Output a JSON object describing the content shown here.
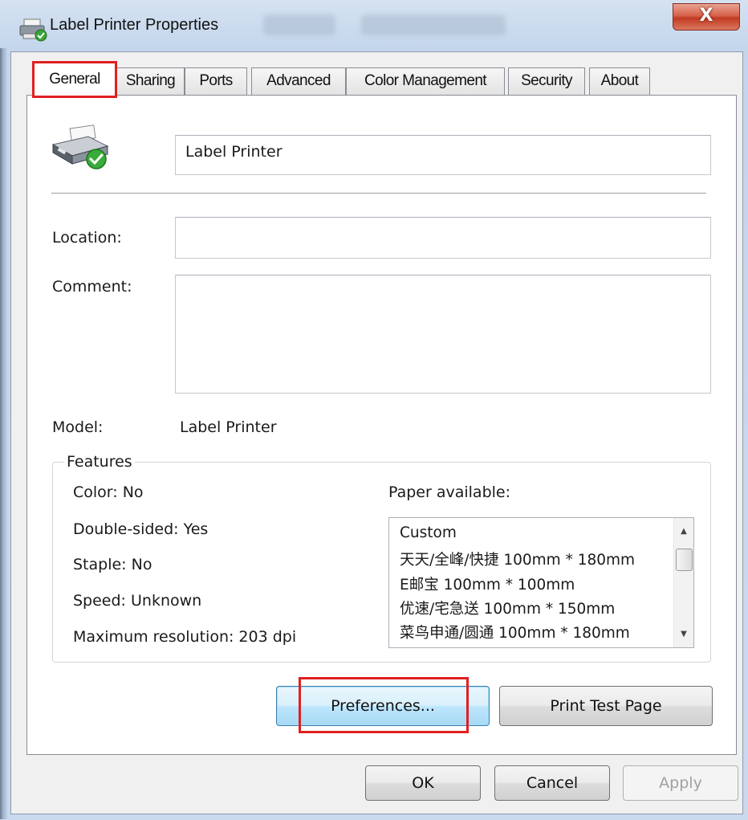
{
  "window": {
    "title": "Label Printer Properties",
    "close_symbol": "X"
  },
  "tabs": [
    {
      "label": "General",
      "active": true
    },
    {
      "label": "Sharing",
      "active": false
    },
    {
      "label": "Ports",
      "active": false
    },
    {
      "label": "Advanced",
      "active": false
    },
    {
      "label": "Color Management",
      "active": false
    },
    {
      "label": "Security",
      "active": false
    },
    {
      "label": "About",
      "active": false
    }
  ],
  "general": {
    "printer_name": "Label Printer",
    "location_label": "Location:",
    "location_value": "",
    "comment_label": "Comment:",
    "comment_value": "",
    "model_label": "Model:",
    "model_value": "Label Printer"
  },
  "features": {
    "group_title": "Features",
    "color": "Color: No",
    "double_sided": "Double-sided: Yes",
    "staple": "Staple: No",
    "speed": "Speed: Unknown",
    "max_resolution": "Maximum resolution: 203 dpi",
    "paper_label": "Paper available:",
    "paper_items": [
      "Custom",
      "天天/全峰/快捷 100mm * 180mm",
      "E邮宝 100mm * 100mm",
      "优速/宅急送 100mm * 150mm",
      "菜鸟申通/圆通 100mm * 180mm"
    ]
  },
  "buttons": {
    "preferences": "Preferences...",
    "print_test_page": "Print Test Page",
    "ok": "OK",
    "cancel": "Cancel",
    "apply": "Apply"
  },
  "icons": {
    "title": "printer-icon",
    "printer": "printer-ready-icon",
    "scroll_up": "▲",
    "scroll_down": "▼"
  },
  "colors": {
    "highlight": "#e02020",
    "close_button": "#c23a22",
    "default_button": "#3c7fb1"
  }
}
